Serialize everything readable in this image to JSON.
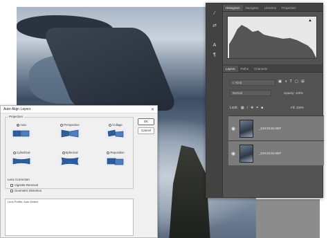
{
  "dialog": {
    "title": "Auto-Align Layers",
    "projection_label": "Projection",
    "projections": [
      {
        "label": "Auto",
        "selected": true
      },
      {
        "label": "Perspective",
        "selected": false
      },
      {
        "label": "Collage",
        "selected": false
      },
      {
        "label": "Cylindrical",
        "selected": false
      },
      {
        "label": "Spherical",
        "selected": false
      },
      {
        "label": "Reposition",
        "selected": false
      }
    ],
    "ok_label": "OK",
    "cancel_label": "Cancel",
    "lens_label": "Lens Correction",
    "vignette_label": "Vignette Removal",
    "distortion_label": "Geometric Distortion",
    "files_header": "Lens Profile: Auto-Detect"
  },
  "panel": {
    "tabs_top": [
      "Histogram",
      "Navigator",
      "Libraries",
      "Properties"
    ],
    "tabs_layers": [
      "Layers",
      "Paths",
      "Channels"
    ],
    "search_placeholder": "Kind",
    "blend_mode": "Normal",
    "opacity_label": "Opacity: 100%",
    "lock_label": "Lock:",
    "fill_label": "Fill: 100%",
    "layers": [
      {
        "name": "_DSC0125.NEF",
        "visible": true
      },
      {
        "name": "_DSC0126.NEF",
        "visible": true
      }
    ]
  },
  "icons": {
    "eye": "eye-icon",
    "warning": "warning-icon",
    "search": "search-icon"
  },
  "colors": {
    "panel_bg": "#535353",
    "selected_layer": "#7b7b7b",
    "dialog_bg": "#f0f0f0"
  }
}
